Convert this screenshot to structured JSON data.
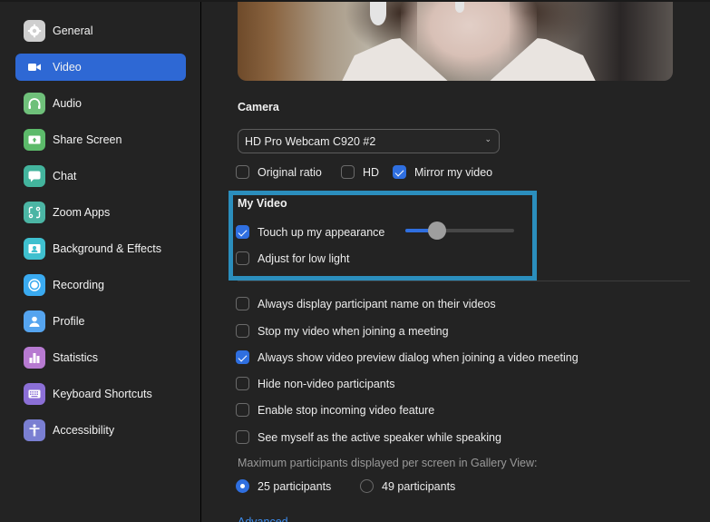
{
  "colors": {
    "accent": "#2e68d4",
    "checkbox_on": "#2f6fe0",
    "highlight_border": "#2b8ebd",
    "link": "#3d8ef0"
  },
  "sidebar": {
    "items": [
      {
        "label": "General",
        "icon": "gear-icon",
        "color": "#cfcfcf",
        "active": false
      },
      {
        "label": "Video",
        "icon": "video-camera-icon",
        "color": "#2e68d4",
        "active": true
      },
      {
        "label": "Audio",
        "icon": "headphones-icon",
        "color": "#6fc07a",
        "active": false
      },
      {
        "label": "Share Screen",
        "icon": "share-screen-icon",
        "color": "#5cba6a",
        "active": false
      },
      {
        "label": "Chat",
        "icon": "chat-bubble-icon",
        "color": "#43b49d",
        "active": false
      },
      {
        "label": "Zoom Apps",
        "icon": "zoom-apps-icon",
        "color": "#4bb5a4",
        "active": false
      },
      {
        "label": "Background & Effects",
        "icon": "background-icon",
        "color": "#3fc0cf",
        "active": false
      },
      {
        "label": "Recording",
        "icon": "record-icon",
        "color": "#3aaaf0",
        "active": false
      },
      {
        "label": "Profile",
        "icon": "profile-icon",
        "color": "#55a4ef",
        "active": false
      },
      {
        "label": "Statistics",
        "icon": "statistics-icon",
        "color": "#b77ad1",
        "active": false
      },
      {
        "label": "Keyboard Shortcuts",
        "icon": "keyboard-icon",
        "color": "#8b6fd6",
        "active": false
      },
      {
        "label": "Accessibility",
        "icon": "accessibility-icon",
        "color": "#7a7fd2",
        "active": false
      }
    ]
  },
  "camera": {
    "title": "Camera",
    "selected_device": "HD Pro Webcam C920 #2",
    "chevron": "⌄",
    "options": [
      {
        "label": "Original ratio",
        "checked": false
      },
      {
        "label": "HD",
        "checked": false
      },
      {
        "label": "Mirror my video",
        "checked": true
      }
    ]
  },
  "my_video": {
    "title": "My Video",
    "touch_up": {
      "label": "Touch up my appearance",
      "checked": true,
      "level": 0.29
    },
    "low_light": {
      "label": "Adjust for low light",
      "checked": false
    }
  },
  "settings": [
    {
      "label": "Always display participant name on their videos",
      "checked": false
    },
    {
      "label": "Stop my video when joining a meeting",
      "checked": false
    },
    {
      "label": "Always show video preview dialog when joining a video meeting",
      "checked": true
    },
    {
      "label": "Hide non-video participants",
      "checked": false
    },
    {
      "label": "Enable stop incoming video feature",
      "checked": false
    },
    {
      "label": "See myself as the active speaker while speaking",
      "checked": false
    }
  ],
  "gallery": {
    "label": "Maximum participants displayed per screen in Gallery View:",
    "options": [
      {
        "label": "25 participants",
        "selected": true
      },
      {
        "label": "49 participants",
        "selected": false
      }
    ]
  },
  "advanced_link": "Advanced"
}
